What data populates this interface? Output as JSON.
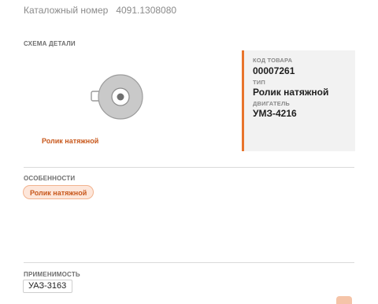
{
  "catalog": {
    "label": "Каталожный номер",
    "number": "4091.1308080"
  },
  "scheme": {
    "title": "СХЕМА ДЕТАЛИ",
    "part_caption": "Ролик натяжной"
  },
  "info": {
    "code_label": "КОД ТОВАРА",
    "code_value": "00007261",
    "type_label": "ТИП",
    "type_value": "Ролик натяжной",
    "engine_label": "ДВИГАТЕЛЬ",
    "engine_value": "УМЗ-4216"
  },
  "features": {
    "title": "ОСОБЕННОСТИ",
    "tags": [
      "Ролик натяжной"
    ]
  },
  "applicability": {
    "title": "ПРИМЕНИМОСТЬ",
    "items": [
      "УАЗ-3163"
    ]
  },
  "colors": {
    "accent": "#e8742c",
    "accent_text": "#c8581c",
    "tag_bg": "#fde6da"
  }
}
